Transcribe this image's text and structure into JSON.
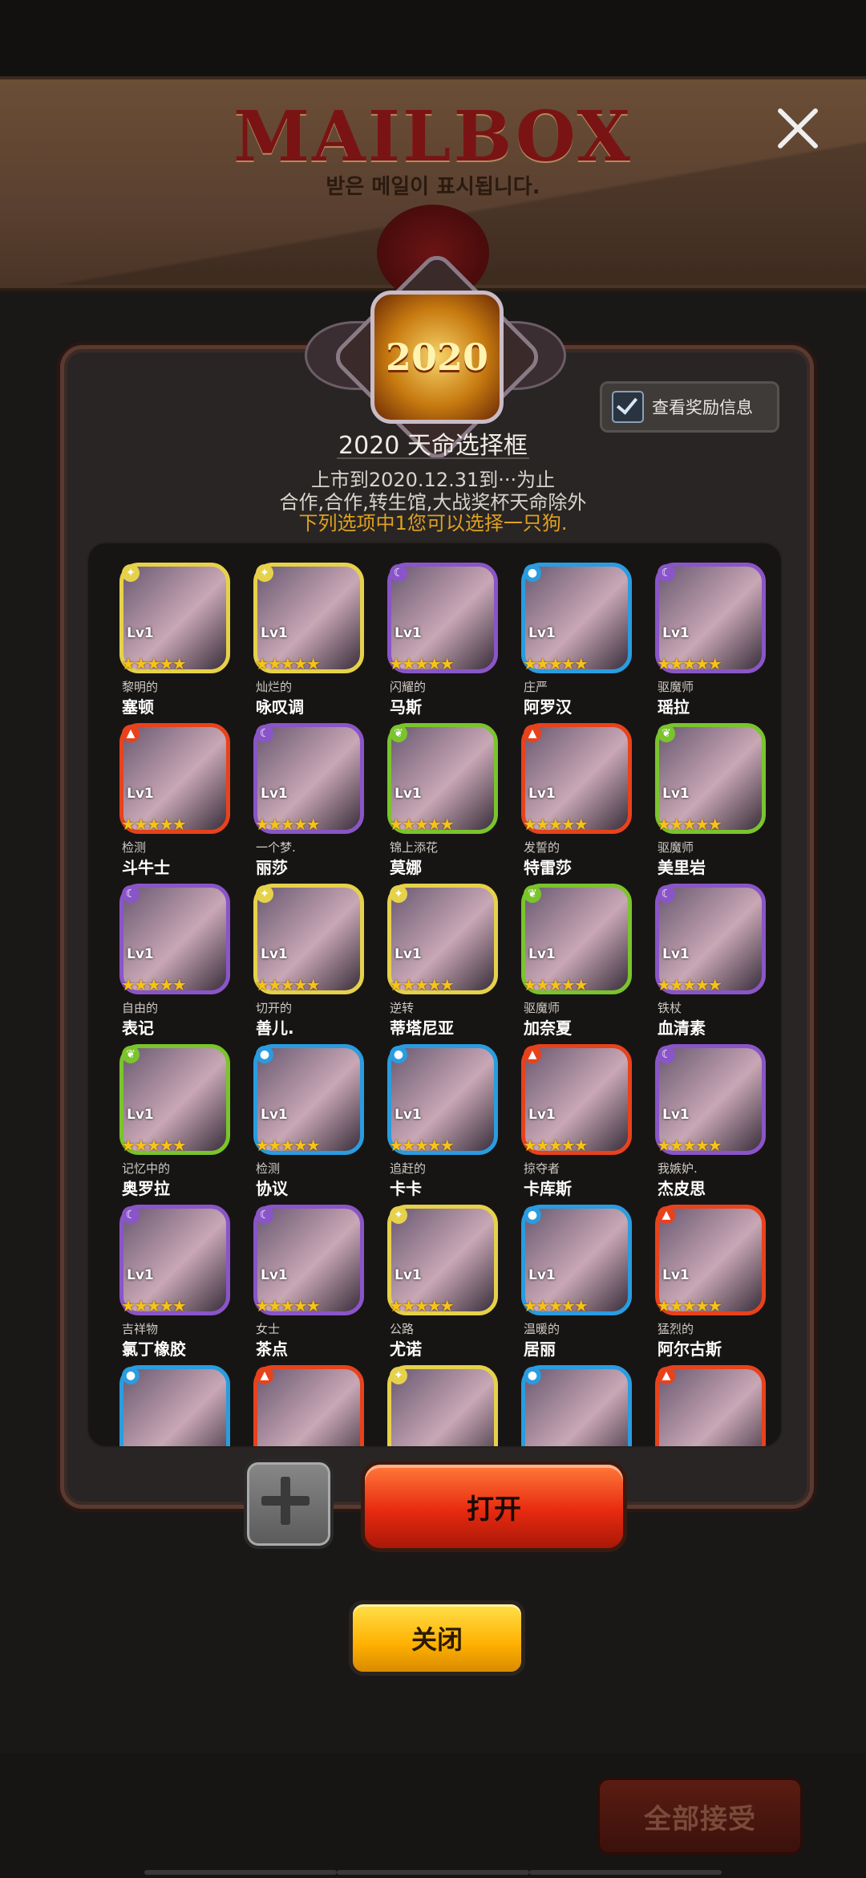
{
  "header": {
    "title": "MAILBOX",
    "subtitle": "받은 메일이 표시됩니다."
  },
  "background": {
    "accept_all_label": "全部接受"
  },
  "dialog": {
    "emblem_text": "2020",
    "reward_info_label": "查看奖励信息",
    "reward_info_checked": true,
    "box_title": "2020 天命选择框",
    "desc_line1": "上市到2020.12.31到···为止",
    "desc_line2": "合作,合作,转生馆,大战奖杯天命除外",
    "desc_line3": "下列选项中1您可以选择一只狗.",
    "open_label": "打开",
    "close_label": "关闭"
  },
  "colors": {
    "light": "#e6d24a",
    "dark": "#8a55c8",
    "water": "#2a9ce0",
    "fire": "#e8421c",
    "wood": "#7ac42c",
    "accent_yellow": "#e0a020"
  },
  "heroes": [
    {
      "epithet": "黎明的",
      "name": "塞顿",
      "element": "light",
      "level": "Lv1",
      "stars": 5
    },
    {
      "epithet": "灿烂的",
      "name": "咏叹调",
      "element": "light",
      "level": "Lv1",
      "stars": 5
    },
    {
      "epithet": "闪耀的",
      "name": "马斯",
      "element": "dark",
      "level": "Lv1",
      "stars": 5
    },
    {
      "epithet": "庄严",
      "name": "阿罗汉",
      "element": "water",
      "level": "Lv1",
      "stars": 5
    },
    {
      "epithet": "驱魔师",
      "name": "瑶拉",
      "element": "dark",
      "level": "Lv1",
      "stars": 5
    },
    {
      "epithet": "检测",
      "name": "斗牛士",
      "element": "fire",
      "level": "Lv1",
      "stars": 5
    },
    {
      "epithet": "一个梦.",
      "name": "丽莎",
      "element": "dark",
      "level": "Lv1",
      "stars": 5
    },
    {
      "epithet": "锦上添花",
      "name": "莫娜",
      "element": "wood",
      "level": "Lv1",
      "stars": 5
    },
    {
      "epithet": "发誓的",
      "name": "特雷莎",
      "element": "fire",
      "level": "Lv1",
      "stars": 5
    },
    {
      "epithet": "驱魔师",
      "name": "美里岩",
      "element": "wood",
      "level": "Lv1",
      "stars": 5
    },
    {
      "epithet": "自由的",
      "name": "表记",
      "element": "dark",
      "level": "Lv1",
      "stars": 5
    },
    {
      "epithet": "切开的",
      "name": "善儿.",
      "element": "light",
      "level": "Lv1",
      "stars": 5
    },
    {
      "epithet": "逆转",
      "name": "蒂塔尼亚",
      "element": "light",
      "level": "Lv1",
      "stars": 5
    },
    {
      "epithet": "驱魔师",
      "name": "加奈夏",
      "element": "wood",
      "level": "Lv1",
      "stars": 5
    },
    {
      "epithet": "铁杖",
      "name": "血清素",
      "element": "dark",
      "level": "Lv1",
      "stars": 5
    },
    {
      "epithet": "记忆中的",
      "name": "奥罗拉",
      "element": "wood",
      "level": "Lv1",
      "stars": 5
    },
    {
      "epithet": "检测",
      "name": "协议",
      "element": "water",
      "level": "Lv1",
      "stars": 5
    },
    {
      "epithet": "追赶的",
      "name": "卡卡",
      "element": "water",
      "level": "Lv1",
      "stars": 5
    },
    {
      "epithet": "掠夺者",
      "name": "卡库斯",
      "element": "fire",
      "level": "Lv1",
      "stars": 5
    },
    {
      "epithet": "我嫉妒.",
      "name": "杰皮思",
      "element": "dark",
      "level": "Lv1",
      "stars": 5
    },
    {
      "epithet": "吉祥物",
      "name": "氯丁橡胶",
      "element": "dark",
      "level": "Lv1",
      "stars": 5
    },
    {
      "epithet": "女士",
      "name": "茶点",
      "element": "dark",
      "level": "Lv1",
      "stars": 5
    },
    {
      "epithet": "公路",
      "name": "尤诺",
      "element": "light",
      "level": "Lv1",
      "stars": 5
    },
    {
      "epithet": "温暖的",
      "name": "居丽",
      "element": "water",
      "level": "Lv1",
      "stars": 5
    },
    {
      "epithet": "猛烈的",
      "name": "阿尔古斯",
      "element": "fire",
      "level": "Lv1",
      "stars": 5
    },
    {
      "epithet": "",
      "name": "",
      "element": "water",
      "level": "",
      "stars": 0
    },
    {
      "epithet": "",
      "name": "",
      "element": "fire",
      "level": "",
      "stars": 0
    },
    {
      "epithet": "",
      "name": "",
      "element": "light",
      "level": "",
      "stars": 0
    },
    {
      "epithet": "",
      "name": "",
      "element": "water",
      "level": "",
      "stars": 0
    },
    {
      "epithet": "",
      "name": "",
      "element": "fire",
      "level": "",
      "stars": 0
    }
  ]
}
